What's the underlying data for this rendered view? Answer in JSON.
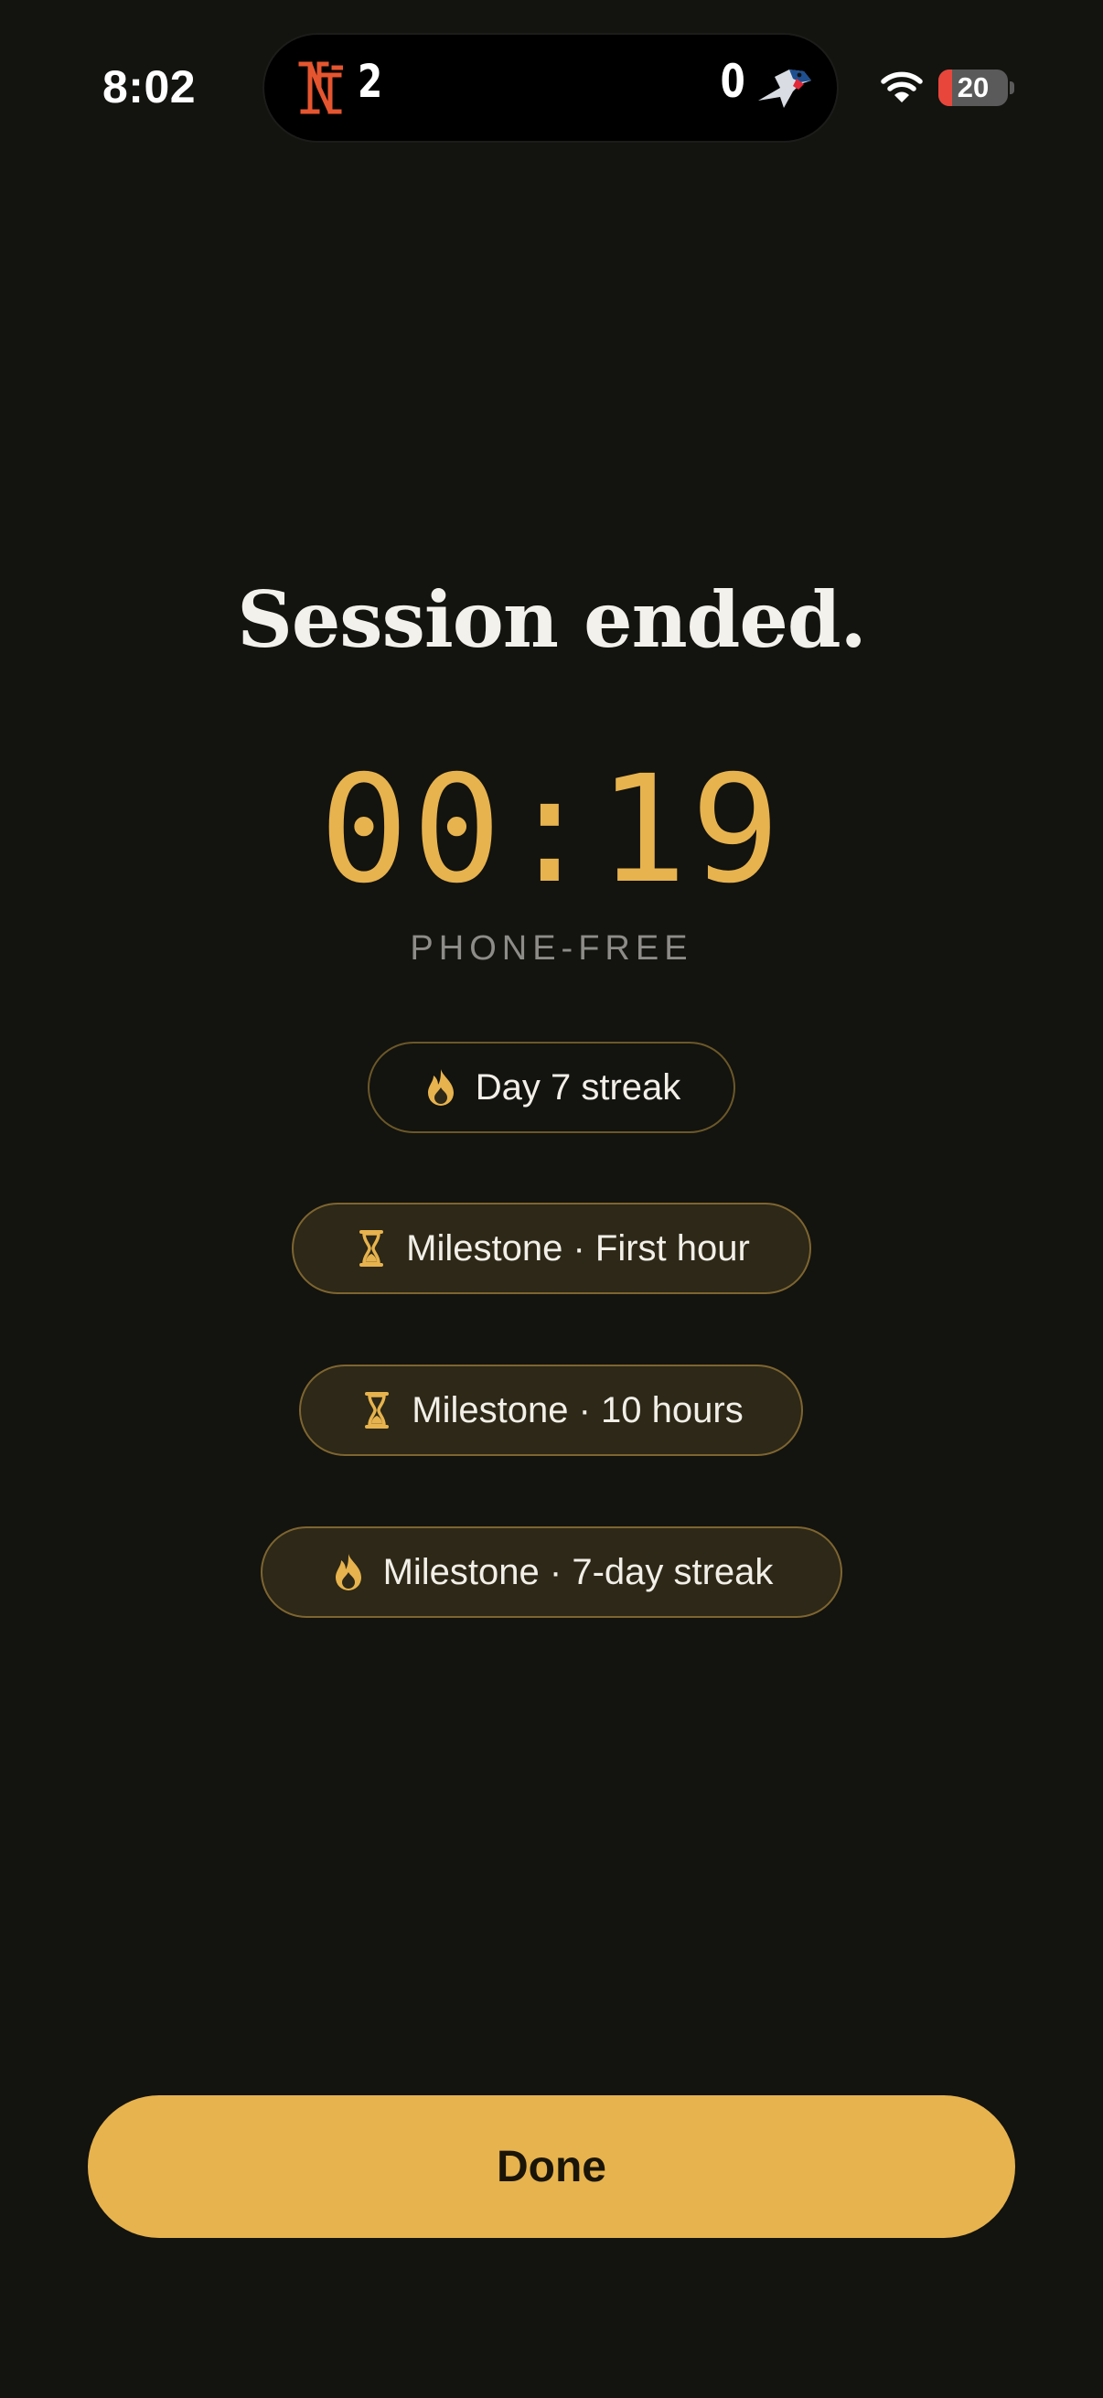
{
  "status_bar": {
    "time": "8:02",
    "live_activity": {
      "left_team_icon": "mets-logo-icon",
      "left_score": "2",
      "right_score": "0",
      "right_team_icon": "blue-jays-logo-icon"
    },
    "wifi_icon": "wifi-icon",
    "battery": {
      "level_text": "20",
      "level_fraction": 0.2,
      "fill_color": "#e8463b"
    }
  },
  "session": {
    "title": "Session ended.",
    "elapsed": "00:19",
    "caption": "PHONE-FREE"
  },
  "badges": [
    {
      "icon": "flame-icon",
      "label": "Day 7 streak",
      "style": "outlined"
    },
    {
      "icon": "hourglass-icon",
      "label": "Milestone · First hour",
      "style": "filled"
    },
    {
      "icon": "hourglass-icon",
      "label": "Milestone · 10 hours",
      "style": "filled"
    },
    {
      "icon": "flame-icon",
      "label": "Milestone · 7-day streak",
      "style": "filled"
    }
  ],
  "actions": {
    "done_label": "Done"
  },
  "colors": {
    "background": "#13130f",
    "accent": "#e7b34e",
    "badge_fill": "#2d2817",
    "caption": "#8d8c89"
  }
}
